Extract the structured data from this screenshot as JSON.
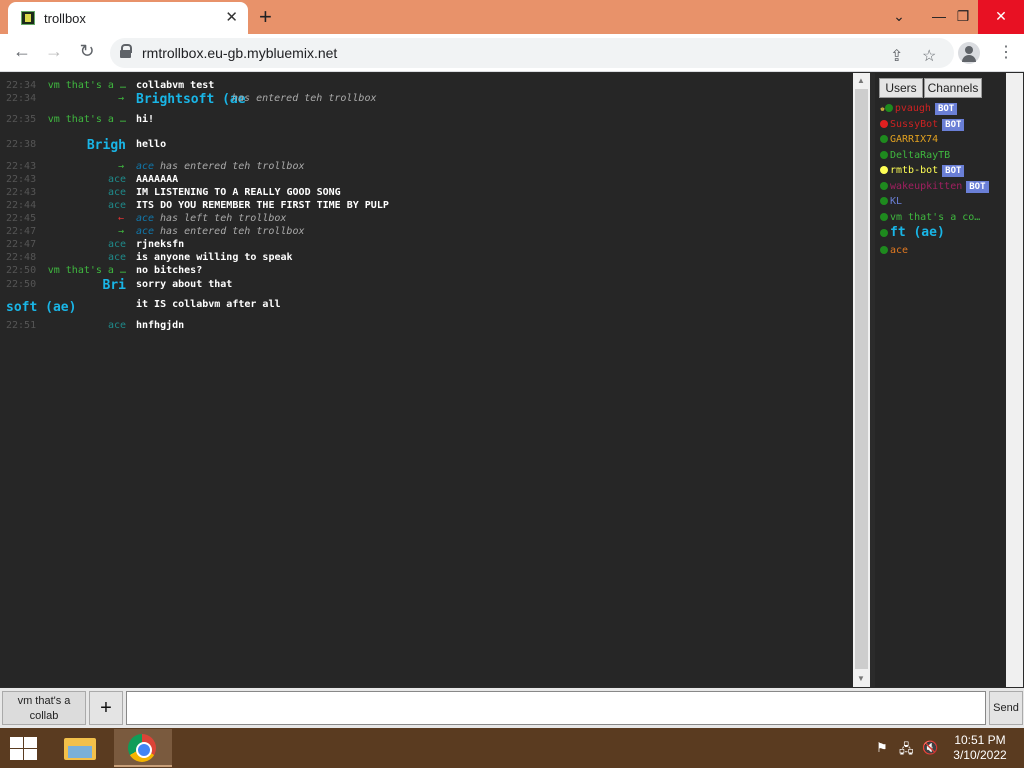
{
  "browser": {
    "tab_title": "trollbox",
    "url": "rmtrollbox.eu-gb.mybluemix.net"
  },
  "messages": [
    {
      "time": "22:34",
      "nick": "vm that's a …",
      "nick_color": "#3fb83f",
      "text": "collabvm test",
      "type": "msg"
    },
    {
      "time": "22:34",
      "nick": "",
      "arrow": "→",
      "arrow_color": "#3fb83f",
      "join_nick": "Brightsoft (ae",
      "join_color": "#19b5e6",
      "text": "has entered teh trollbox",
      "type": "join-big"
    },
    {
      "time": "22:35",
      "nick": "vm that's a …",
      "nick_color": "#3fb83f",
      "text": "hi!",
      "type": "msg"
    },
    {
      "time": "22:38",
      "nick": "Brigh",
      "nick_color": "#19b5e6",
      "text": "hello",
      "type": "msg-big"
    },
    {
      "time": "22:43",
      "nick": "",
      "arrow": "→",
      "arrow_color": "#3fb83f",
      "join_nick": "ace",
      "join_color": "#17a",
      "text": "has entered teh trollbox",
      "type": "join"
    },
    {
      "time": "22:43",
      "nick": "ace",
      "nick_color": "#1f8a8a",
      "text": "AAAAAAA",
      "type": "msg"
    },
    {
      "time": "22:43",
      "nick": "ace",
      "nick_color": "#1f8a8a",
      "text": "IM LISTENING TO A REALLY GOOD SONG",
      "type": "msg"
    },
    {
      "time": "22:44",
      "nick": "ace",
      "nick_color": "#1f8a8a",
      "text": "ITS DO YOU REMEMBER THE FIRST TIME BY PULP",
      "type": "msg"
    },
    {
      "time": "22:45",
      "nick": "",
      "arrow": "←",
      "arrow_color": "#d33",
      "join_nick": "ace",
      "join_color": "#17a",
      "text": "has left teh trollbox",
      "type": "join"
    },
    {
      "time": "22:47",
      "nick": "",
      "arrow": "→",
      "arrow_color": "#3fb83f",
      "join_nick": "ace",
      "join_color": "#17a",
      "text": "has entered teh trollbox",
      "type": "join"
    },
    {
      "time": "22:47",
      "nick": "ace",
      "nick_color": "#1f8a8a",
      "text": "rjneksfn",
      "type": "msg"
    },
    {
      "time": "22:48",
      "nick": "ace",
      "nick_color": "#1f8a8a",
      "text": "is anyone willing to speak",
      "type": "msg"
    },
    {
      "time": "22:50",
      "nick": "vm that's a …",
      "nick_color": "#3fb83f",
      "text": "no bitches?",
      "type": "msg"
    },
    {
      "time": "22:50",
      "nick": "Bri",
      "nick_color": "#19b5e6",
      "text": "sorry about that",
      "type": "msg-big"
    },
    {
      "time": "22:50",
      "nick": "soft (ae)",
      "nick_color": "#19b5e6",
      "text": "it IS collabvm after all",
      "type": "msg-wrap"
    },
    {
      "time": "22:51",
      "nick": "ace",
      "nick_color": "#1f8a8a",
      "text": "hnfhgjdn",
      "type": "msg"
    }
  ],
  "sidebar": {
    "tab_users": "Users",
    "tab_channels": "Channels",
    "users": [
      {
        "name": "pvaugh",
        "color": "#cc2222",
        "dot": "#1e8a1e",
        "bot": "BOT",
        "crown": "♚"
      },
      {
        "name": "SussyBot",
        "color": "#cc2222",
        "dot": "#e02020",
        "bot": "BOT"
      },
      {
        "name": "GARRIX74",
        "color": "#e0a020",
        "dot": "#1e8a1e"
      },
      {
        "name": "DeltaRayTB",
        "color": "#3fb83f",
        "dot": "#1e8a1e"
      },
      {
        "name": "rmtb-bot",
        "color": "#ffff55",
        "dot": "#ffff55",
        "bot": "BOT"
      },
      {
        "name": "wakeupkitten",
        "color": "#a02060",
        "dot": "#1e8a1e",
        "bot": "BOT"
      },
      {
        "name": "KL",
        "color": "#6a7fd6",
        "dot": "#1e8a1e"
      },
      {
        "name": "vm that's a co…",
        "color": "#3fb83f",
        "dot": "#1e8a1e"
      },
      {
        "name": "ft (ae)",
        "color": "#19b5e6",
        "dot": "#1e8a1e"
      },
      {
        "name": "ace",
        "color": "#e07820",
        "dot": "#1e8a1e"
      }
    ]
  },
  "bottom": {
    "room_label": "vm that's a collab",
    "add_label": "+",
    "send_label": "Send",
    "input_value": ""
  },
  "taskbar": {
    "time": "10:51 PM",
    "date": "3/10/2022"
  }
}
